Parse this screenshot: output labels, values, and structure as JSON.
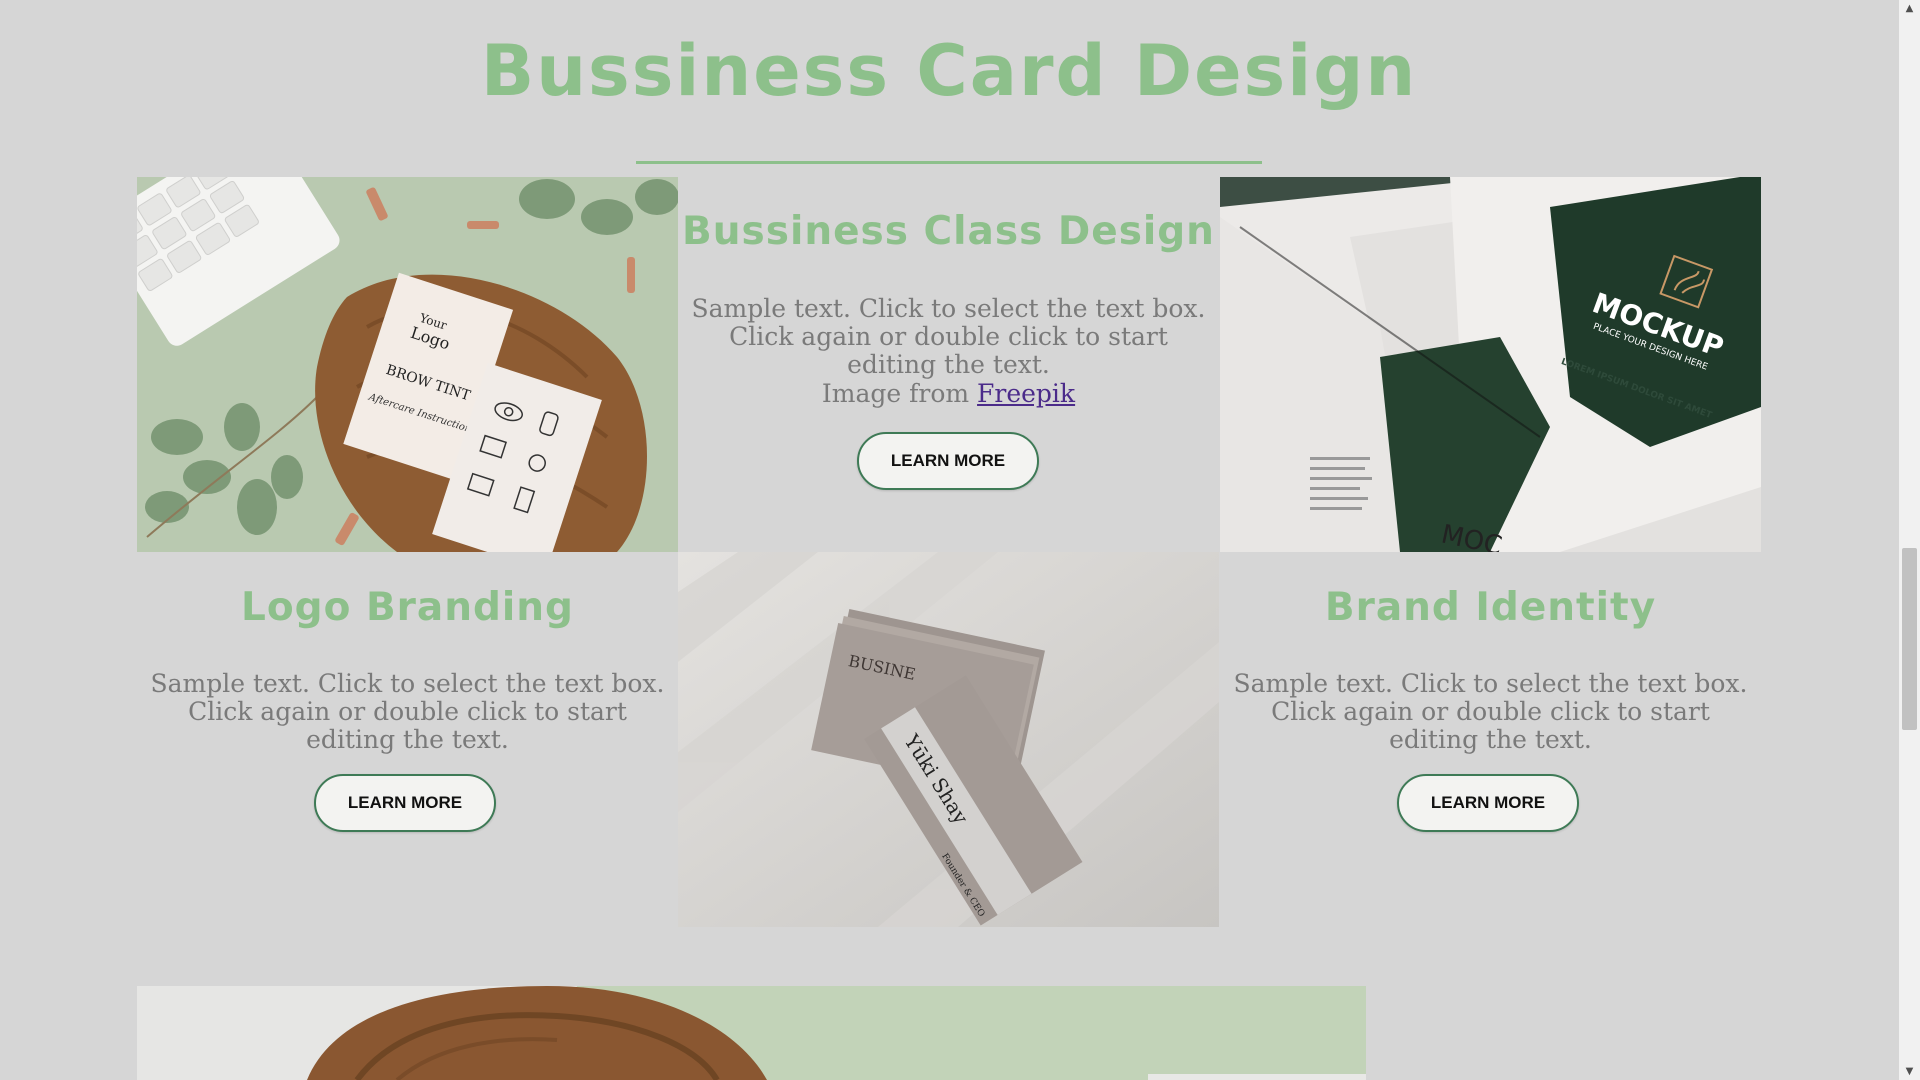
{
  "page": {
    "title": "Bussiness Card Design"
  },
  "cards": {
    "business_class": {
      "heading": "Bussiness Class Design",
      "body": "Sample text. Click to select the text box. Click again or double click to start editing the text.",
      "credit_prefix": "Image from ",
      "credit_link": "Freepik",
      "button": "LEARN MORE"
    },
    "logo_branding": {
      "heading": "Logo Branding",
      "body": "Sample text. Click to select the text box. Click again or double click to start editing the text.",
      "button": "LEARN MORE"
    },
    "brand_identity": {
      "heading": "Brand Identity",
      "body": "Sample text. Click to select the text box. Click again or double click to start editing the text.",
      "button": "LEARN MORE"
    }
  },
  "images": {
    "card_on_board": {
      "logo_line1": "Your",
      "logo_line2": "Logo",
      "tagline": "BROW TINT",
      "script": "Aftercare Instructions"
    },
    "mockup_brochure": {
      "brand": "MOCKUP",
      "sub": "PLACE YOUR DESIGN HERE",
      "lorem": "LOREM IPSUM DOLOR SIT AMET"
    },
    "stacked_cards": {
      "name": "Yūki Shay",
      "role": "Founder & CEO",
      "back": "BUSINE"
    }
  },
  "colors": {
    "accent": "#8dc08b",
    "background": "#d6d6d6",
    "button_border": "#3e7a56"
  },
  "scrollbar": {
    "up_icon": "▲",
    "down_icon": "▼"
  }
}
